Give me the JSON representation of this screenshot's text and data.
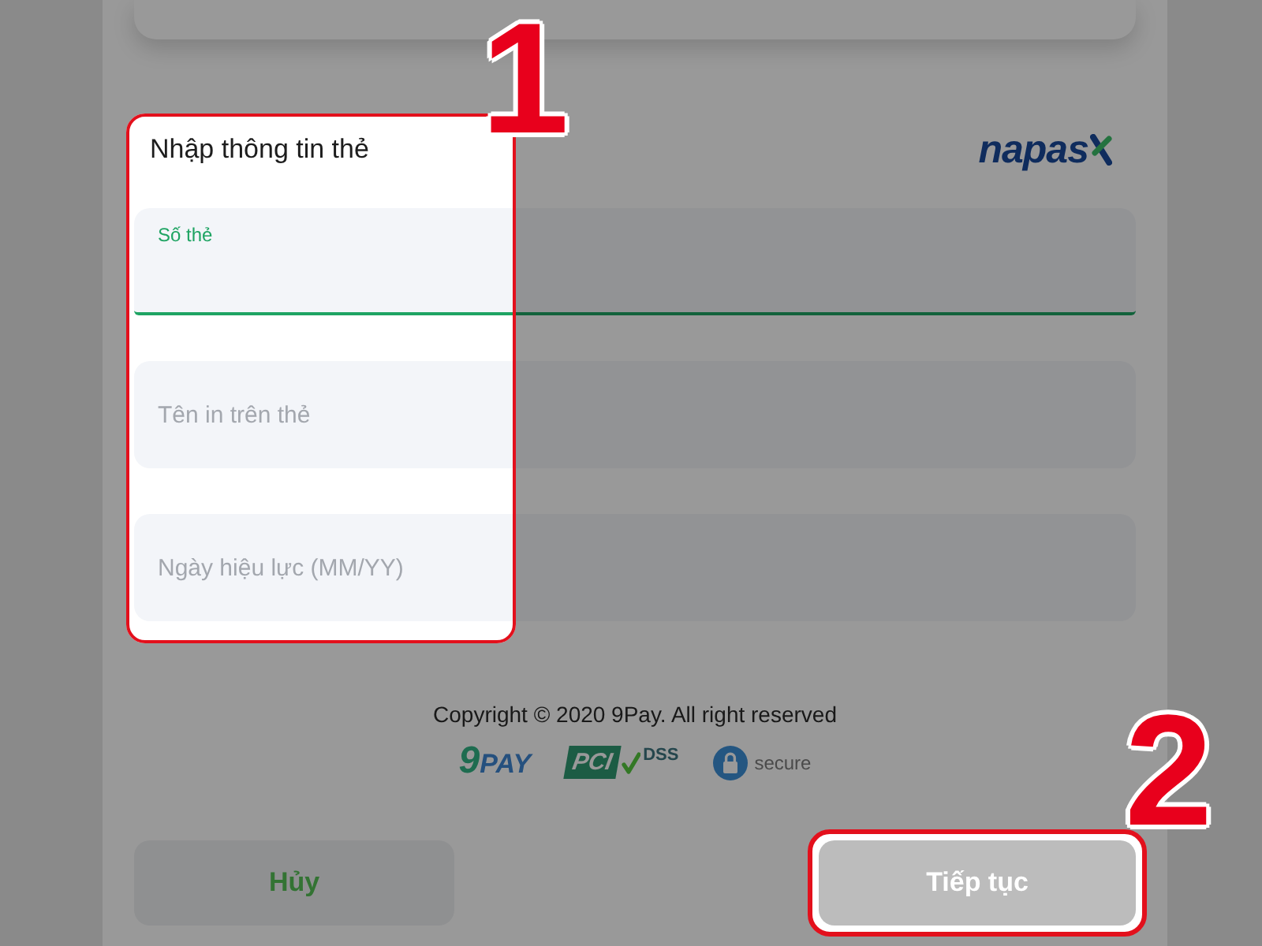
{
  "card_form": {
    "title": "Nhập thông tin thẻ",
    "brand": "napas",
    "fields": [
      {
        "placeholder": "Số thẻ",
        "focused": true
      },
      {
        "placeholder": "Tên in trên thẻ",
        "focused": false
      },
      {
        "placeholder": "Ngày hiệu lực (MM/YY)",
        "focused": false
      }
    ]
  },
  "footer": {
    "copyright": "Copyright © 2020 9Pay. All right reserved",
    "badges": [
      {
        "kind": "ninepay",
        "text": "9PAY"
      },
      {
        "kind": "pci",
        "text": "PCI",
        "sub": "DSS"
      },
      {
        "kind": "secure",
        "text": "secure"
      }
    ]
  },
  "buttons": [
    {
      "label": "Hủy",
      "kind": "secondary",
      "disabled": false,
      "highlighted": false
    },
    {
      "label": "Tiếp tục",
      "kind": "primary",
      "disabled": true,
      "highlighted": true
    }
  ],
  "annotations": [
    {
      "number": "1"
    },
    {
      "number": "2"
    }
  ]
}
